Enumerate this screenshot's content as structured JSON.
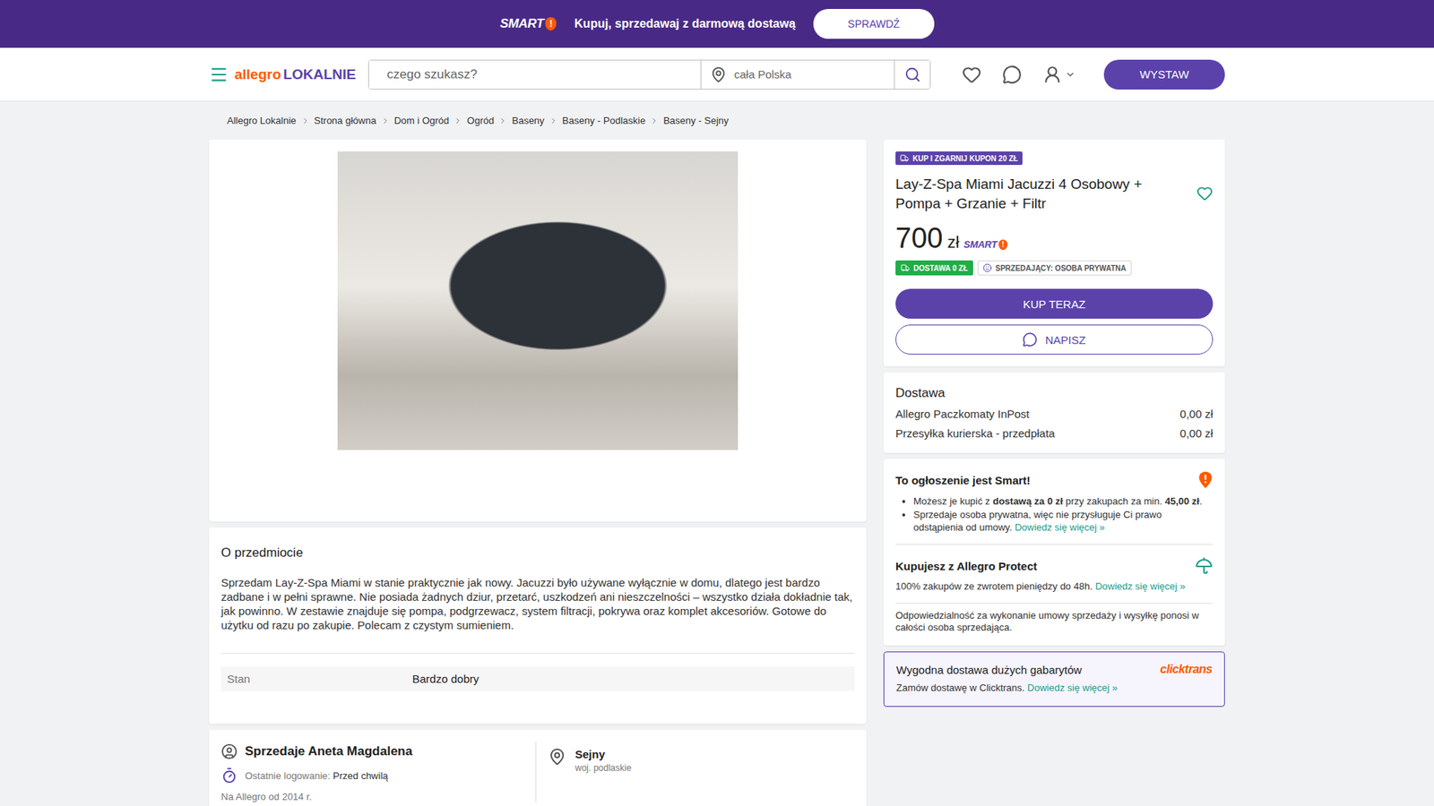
{
  "promo_bar": {
    "logo": {
      "word": "SMART",
      "mark": "!"
    },
    "text": "Kupuj, sprzedawaj z darmową dostawą",
    "button": "SPRAWDŹ"
  },
  "header": {
    "logo": {
      "brand": "allegro",
      "suffix": "LOKALNIE"
    },
    "search": {
      "placeholder": "czego szukasz?"
    },
    "location": {
      "placeholder": "cała Polska"
    },
    "button": "WYSTAW"
  },
  "breadcrumbs": [
    "Allegro Lokalnie",
    "Strona główna",
    "Dom i Ogród",
    "Ogród",
    "Baseny",
    "Baseny - Podlaskie",
    "Baseny - Sejny"
  ],
  "product": {
    "badge": "KUP I ZGARNIJ KUPON 20 ZŁ",
    "title": "Lay-Z-Spa Miami Jacuzzi 4 Osobowy + Pompa + Grzanie + Filtr",
    "favorite": false,
    "price": "700",
    "currency": "zł",
    "smart_logo": {
      "word": "SMART",
      "mark": "!"
    },
    "tags": [
      {
        "label": "DOSTAWA 0 ZŁ",
        "kind": "delivery"
      },
      {
        "label": "SPRZEDAJĄCY: OSOBA PRYWATNA",
        "kind": "seller"
      }
    ],
    "buy_button": "KUP TERAZ",
    "message_button": "NAPISZ"
  },
  "delivery": {
    "title": "Dostawa",
    "options": [
      {
        "name": "Allegro Paczkomaty InPost",
        "price": "0,00 zł"
      },
      {
        "name": "Przesyłka kurierska - przedpłata",
        "price": "0,00 zł"
      }
    ]
  },
  "smart_info": {
    "title": "To ogłoszenie jest Smart!",
    "bullets": [
      [
        {
          "text": "Możesz je kupić z ",
          "kind": "text"
        },
        {
          "text": "dostawą za 0 zł",
          "kind": "bold"
        },
        {
          "text": " przy zakupach za min. ",
          "kind": "text"
        },
        {
          "text": "45,00 zł",
          "kind": "bold"
        },
        {
          "text": ".",
          "kind": "text"
        }
      ],
      [
        {
          "text": "Sprzedaje osoba prywatna, więc nie przysługuje Ci prawo odstąpienia od umowy. ",
          "kind": "text"
        },
        {
          "text": "Dowiedz się więcej »",
          "kind": "link"
        }
      ]
    ]
  },
  "protect": {
    "title": "Kupujesz z Allegro Protect",
    "text": [
      {
        "text": "100% zakupów ze zwrotem pieniędzy do 48h. ",
        "kind": "text"
      },
      {
        "text": "Dowiedz się więcej »",
        "kind": "link"
      }
    ]
  },
  "responsibility": "Odpowiedzialność za wykonanie umowy sprzedaży i wysyłkę ponosi w całości osoba sprzedająca.",
  "clicktrans": {
    "title": "Wygodna dostawa dużych gabarytów",
    "logo": "clicktrans",
    "text": [
      {
        "text": "Zamów dostawę w Clicktrans. ",
        "kind": "text"
      },
      {
        "text": "Dowiedz się więcej »",
        "kind": "link"
      }
    ]
  },
  "about": {
    "title": "O przedmiocie",
    "description": "Sprzedam Lay-Z-Spa Miami w stanie praktycznie jak nowy. Jacuzzi było używane wyłącznie w domu, dlatego jest bardzo zadbane i w pełni sprawne. Nie posiada żadnych dziur, przetarć, uszkodzeń ani nieszczelności – wszystko działa dokładnie tak, jak powinno. W zestawie znajduje się pompa, podgrzewacz, system filtracji, pokrywa oraz komplet akcesoriów. Gotowe do użytku od razu po zakupie. Polecam z czystym sumieniem.",
    "attributes": [
      {
        "name": "Stan",
        "value": "Bardzo dobry"
      }
    ]
  },
  "seller": {
    "name": "Sprzedaje Aneta Magdalena",
    "last_login_label": "Ostatnie logowanie:",
    "last_login": "Przed chwilą",
    "since": "Na Allegro od 2014 r.",
    "city": "Sejny",
    "region": "woj. podlaskie"
  }
}
